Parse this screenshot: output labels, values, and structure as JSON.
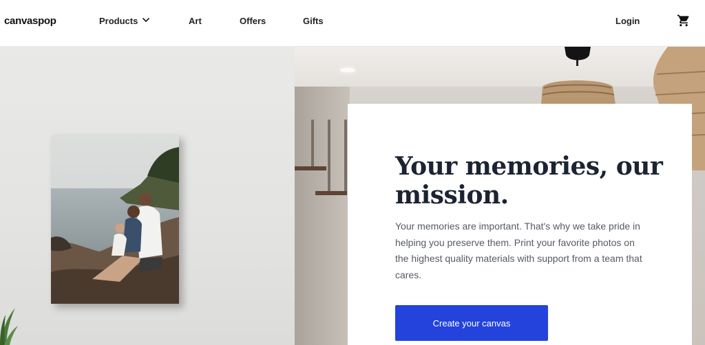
{
  "header": {
    "logo": "canvaspop",
    "nav": [
      {
        "label": "Products",
        "has_dropdown": true
      },
      {
        "label": "Art"
      },
      {
        "label": "Offers"
      },
      {
        "label": "Gifts"
      }
    ],
    "login": "Login",
    "cart_icon": "shopping-cart-icon"
  },
  "hero": {
    "heading": "Your memories, our mission.",
    "body": "Your memories are important. That's why we take pride in helping you preserve them. Print your favorite photos on the highest quality materials with support from a team that cares.",
    "cta_label": "Create your canvas",
    "colors": {
      "cta_background": "#2443dc",
      "heading": "#1c2333",
      "body_text": "#555a62"
    }
  }
}
